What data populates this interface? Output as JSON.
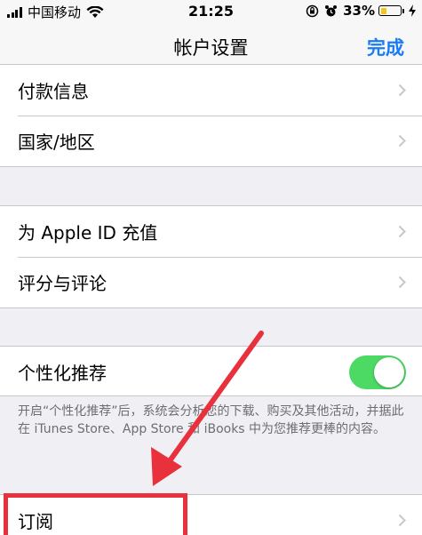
{
  "status_bar": {
    "carrier": "中国移动",
    "time": "21:25",
    "battery": "33%",
    "battery_level": 0.33
  },
  "nav": {
    "title": "帐户设置",
    "done": "完成"
  },
  "group1": {
    "items": [
      {
        "label": "付款信息"
      },
      {
        "label": "国家/地区"
      }
    ]
  },
  "group2": {
    "items": [
      {
        "label": "为 Apple ID 充值"
      },
      {
        "label": "评分与评论"
      }
    ]
  },
  "group3": {
    "personalized": {
      "label": "个性化推荐",
      "toggle_on": true
    },
    "footnote": "开启“个性化推荐”后，系统会分析您的下载、购买及其他活动，并据此在 iTunes Store、App Store 和 iBooks 中为您推荐更棒的内容。"
  },
  "group4": {
    "items": [
      {
        "label": "订阅"
      }
    ]
  },
  "annotation": {
    "color": "#e8313c"
  }
}
